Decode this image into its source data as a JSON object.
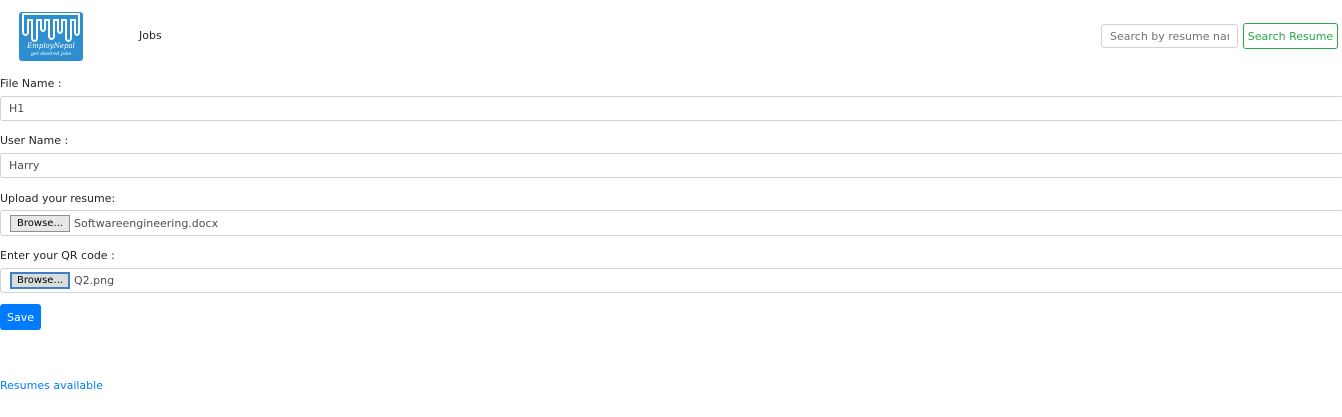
{
  "brand": {
    "name": "EmployNepal",
    "tagline": "get desired jobs",
    "color": "#2e8fd0"
  },
  "nav": {
    "jobs_label": "Jobs"
  },
  "search": {
    "placeholder": "Search by resume name",
    "button_label": "Search Resume"
  },
  "form": {
    "file_name": {
      "label": "File Name :",
      "value": "H1"
    },
    "user_name": {
      "label": "User Name :",
      "value": "Harry"
    },
    "resume": {
      "label": "Upload your resume:",
      "browse_label": "Browse...",
      "file": "Softwareengineering.docx"
    },
    "qr": {
      "label": "Enter your QR code :",
      "browse_label": "Browse...",
      "file": "Q2.png"
    },
    "save_label": "Save"
  },
  "footer": {
    "resumes_link": "Resumes available"
  },
  "colors": {
    "primary": "#007bff",
    "success": "#28a745",
    "border": "#ced4da"
  }
}
